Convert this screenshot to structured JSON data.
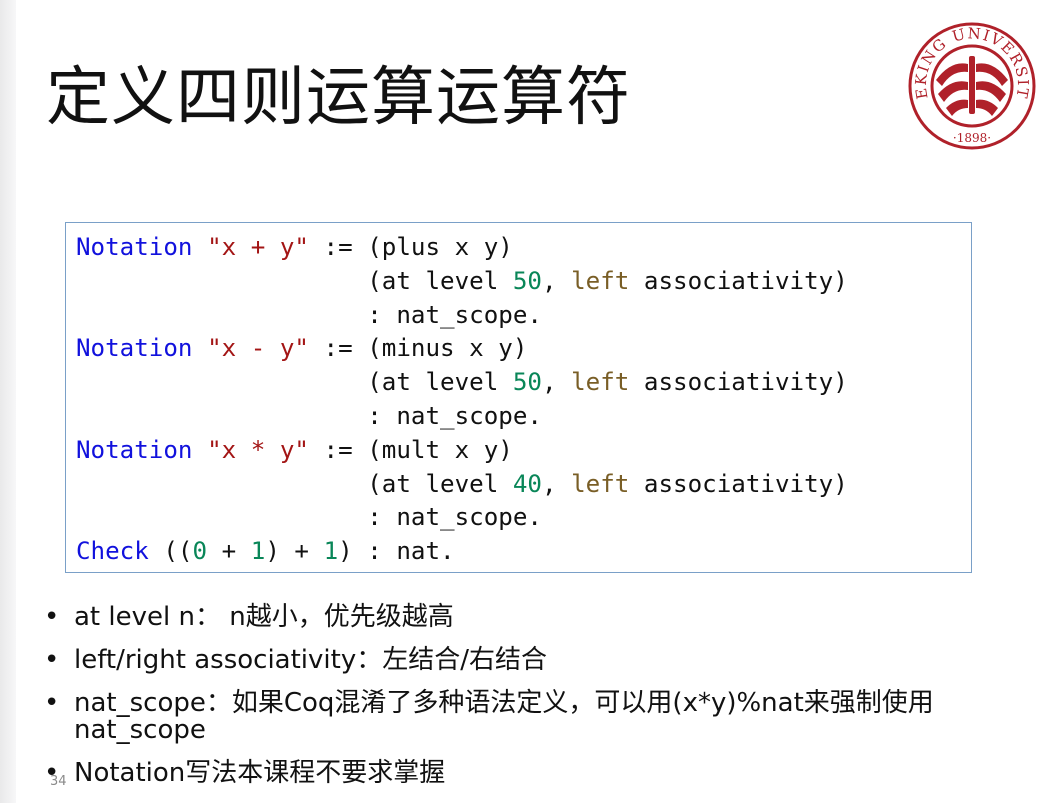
{
  "slide": {
    "title": "定义四则运算运算符",
    "page_number": "34"
  },
  "logo": {
    "name": "peking-university-seal",
    "ring_text": "PEKING UNIVERSITY",
    "year": "·1898·",
    "color": "#b0212a"
  },
  "code_lines": [
    [
      {
        "t": "Notation",
        "c": "kw"
      },
      {
        "t": " "
      },
      {
        "t": "\"x + y\"",
        "c": "str"
      },
      {
        "t": " := (plus x y)"
      }
    ],
    [
      {
        "t": "                    (at level "
      },
      {
        "t": "50",
        "c": "num"
      },
      {
        "t": ", "
      },
      {
        "t": "left",
        "c": "attr"
      },
      {
        "t": " associativity)"
      }
    ],
    [
      {
        "t": "                    : nat_scope."
      }
    ],
    [
      {
        "t": "Notation",
        "c": "kw"
      },
      {
        "t": " "
      },
      {
        "t": "\"x - y\"",
        "c": "str"
      },
      {
        "t": " := (minus x y)"
      }
    ],
    [
      {
        "t": "                    (at level "
      },
      {
        "t": "50",
        "c": "num"
      },
      {
        "t": ", "
      },
      {
        "t": "left",
        "c": "attr"
      },
      {
        "t": " associativity)"
      }
    ],
    [
      {
        "t": "                    : nat_scope."
      }
    ],
    [
      {
        "t": "Notation",
        "c": "kw"
      },
      {
        "t": " "
      },
      {
        "t": "\"x * y\"",
        "c": "str"
      },
      {
        "t": " := (mult x y)"
      }
    ],
    [
      {
        "t": "                    (at level "
      },
      {
        "t": "40",
        "c": "num"
      },
      {
        "t": ", "
      },
      {
        "t": "left",
        "c": "attr"
      },
      {
        "t": " associativity)"
      }
    ],
    [
      {
        "t": "                    : nat_scope."
      }
    ],
    [
      {
        "t": "Check",
        "c": "kw"
      },
      {
        "t": " (("
      },
      {
        "t": "0",
        "c": "num"
      },
      {
        "t": " + "
      },
      {
        "t": "1",
        "c": "num"
      },
      {
        "t": ") + "
      },
      {
        "t": "1",
        "c": "num"
      },
      {
        "t": ") : nat."
      }
    ]
  ],
  "bullets": [
    "at level n： n越小，优先级越高",
    "left/right associativity：左结合/右结合",
    "nat_scope：如果Coq混淆了多种语法定义，可以用(x*y)%nat来强制使用nat_scope",
    "Notation写法本课程不要求掌握"
  ]
}
